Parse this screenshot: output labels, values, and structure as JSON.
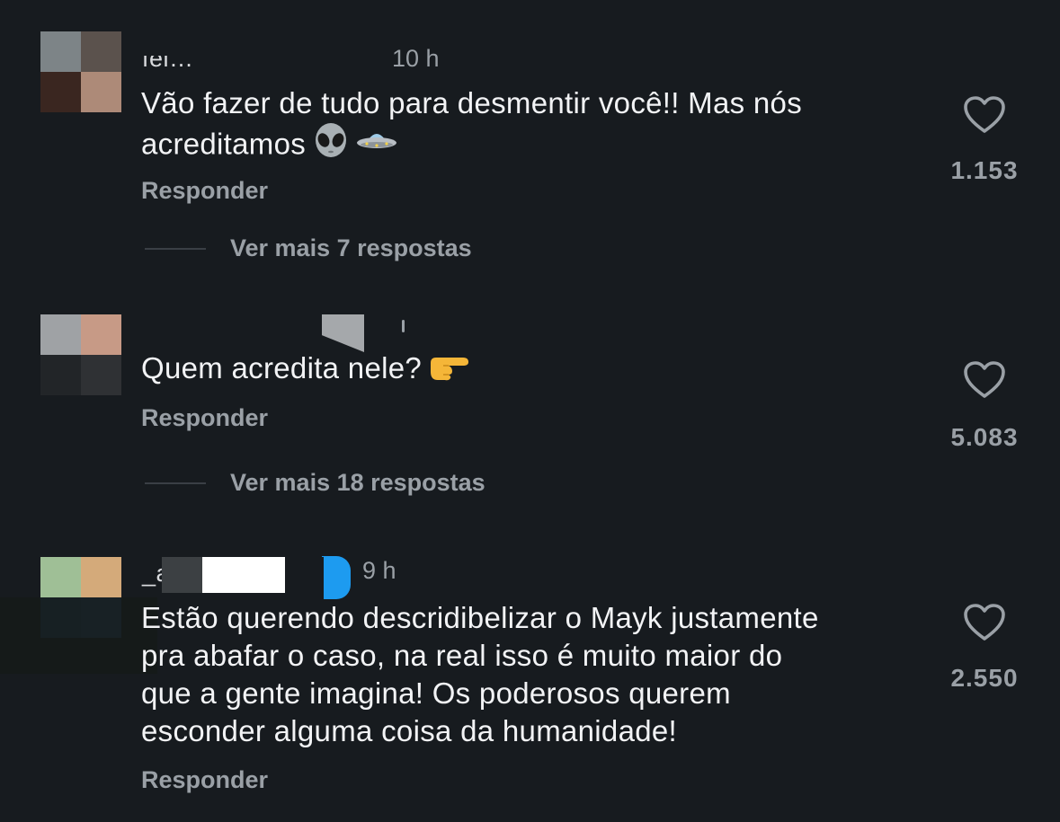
{
  "comments": [
    {
      "username": "fel…",
      "time": "10 h",
      "text": "Vão fazer de tudo para desmentir você!! Mas nós\nacreditamos",
      "emojis": [
        "alien-emoji",
        "flying-saucer-emoji"
      ],
      "reply_label": "Responder",
      "more_replies": "Ver mais 7 respostas",
      "likes": "1.153"
    },
    {
      "username": "",
      "time": "",
      "text": "Quem acredita nele?",
      "emojis": [
        "backhand-index-pointing-right-emoji"
      ],
      "reply_label": "Responder",
      "more_replies": "Ver mais 18 respostas",
      "likes": "5.083"
    },
    {
      "username": "_a",
      "time": "9 h",
      "text": "Estão querendo descridibelizar o Mayk justamente\npra abafar o caso, na real isso é muito maior do\nque a gente imagina! Os poderosos querem\nesconder alguma coisa da humanidade!",
      "emojis": [],
      "reply_label": "Responder",
      "likes": "2.550"
    }
  ],
  "colors": {
    "background": "#171b1f",
    "text": "#f2f3f5",
    "muted": "#9aa0a6",
    "verified_badge": "#1d9bf0"
  }
}
